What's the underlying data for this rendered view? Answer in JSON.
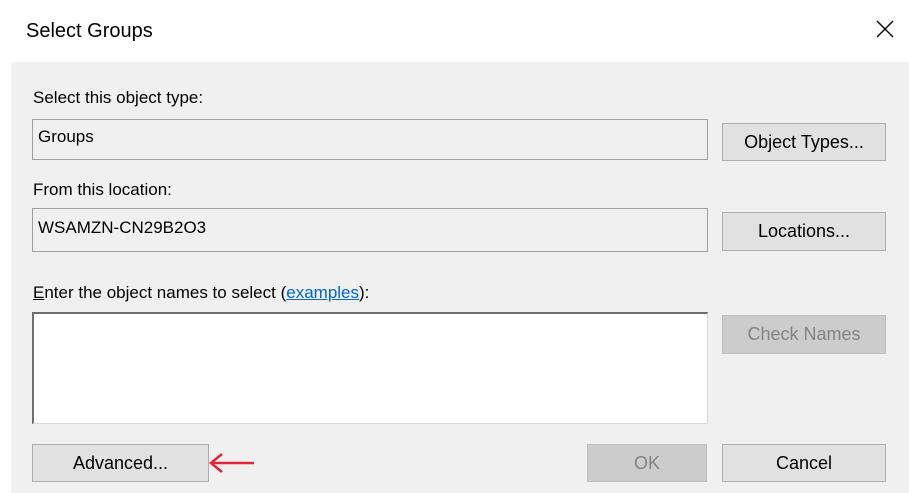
{
  "dialog": {
    "title": "Select Groups",
    "close_icon": "close-icon"
  },
  "object_type": {
    "label": "Select this object type:",
    "value": "Groups",
    "button": "Object Types..."
  },
  "location": {
    "label": "From this location:",
    "value": "WSAMZN-CN29B2O3",
    "button": "Locations..."
  },
  "names": {
    "label_prefix": "Enter the object names to select (",
    "label_link": "examples",
    "label_suffix": "):",
    "value": "",
    "check_button": "Check Names"
  },
  "footer": {
    "advanced_button": "Advanced...",
    "ok_button": "OK",
    "cancel_button": "Cancel"
  },
  "annotation": {
    "arrow_color": "#e0263a",
    "icon": "left-arrow-icon"
  }
}
